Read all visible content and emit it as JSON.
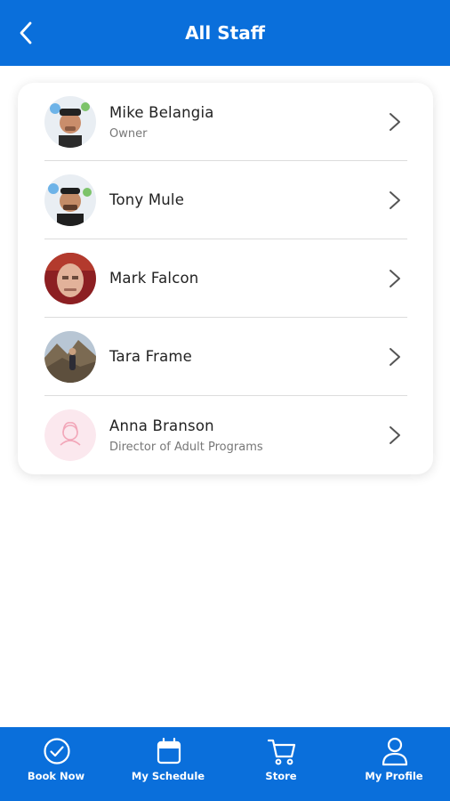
{
  "header": {
    "title": "All Staff"
  },
  "staff": [
    {
      "name": "Mike Belangia",
      "role": "Owner"
    },
    {
      "name": "Tony Mule",
      "role": ""
    },
    {
      "name": "Mark Falcon",
      "role": ""
    },
    {
      "name": "Tara Frame",
      "role": ""
    },
    {
      "name": "Anna Branson",
      "role": "Director of Adult Programs"
    }
  ],
  "tabs": [
    {
      "label": "Book Now",
      "icon": "check-circle-icon"
    },
    {
      "label": "My Schedule",
      "icon": "calendar-icon"
    },
    {
      "label": "Store",
      "icon": "cart-icon"
    },
    {
      "label": "My Profile",
      "icon": "user-icon"
    }
  ],
  "colors": {
    "primary": "#0a6fdb",
    "divider": "#dcdcdc",
    "placeholder_avatar": "#f2a7b9"
  }
}
